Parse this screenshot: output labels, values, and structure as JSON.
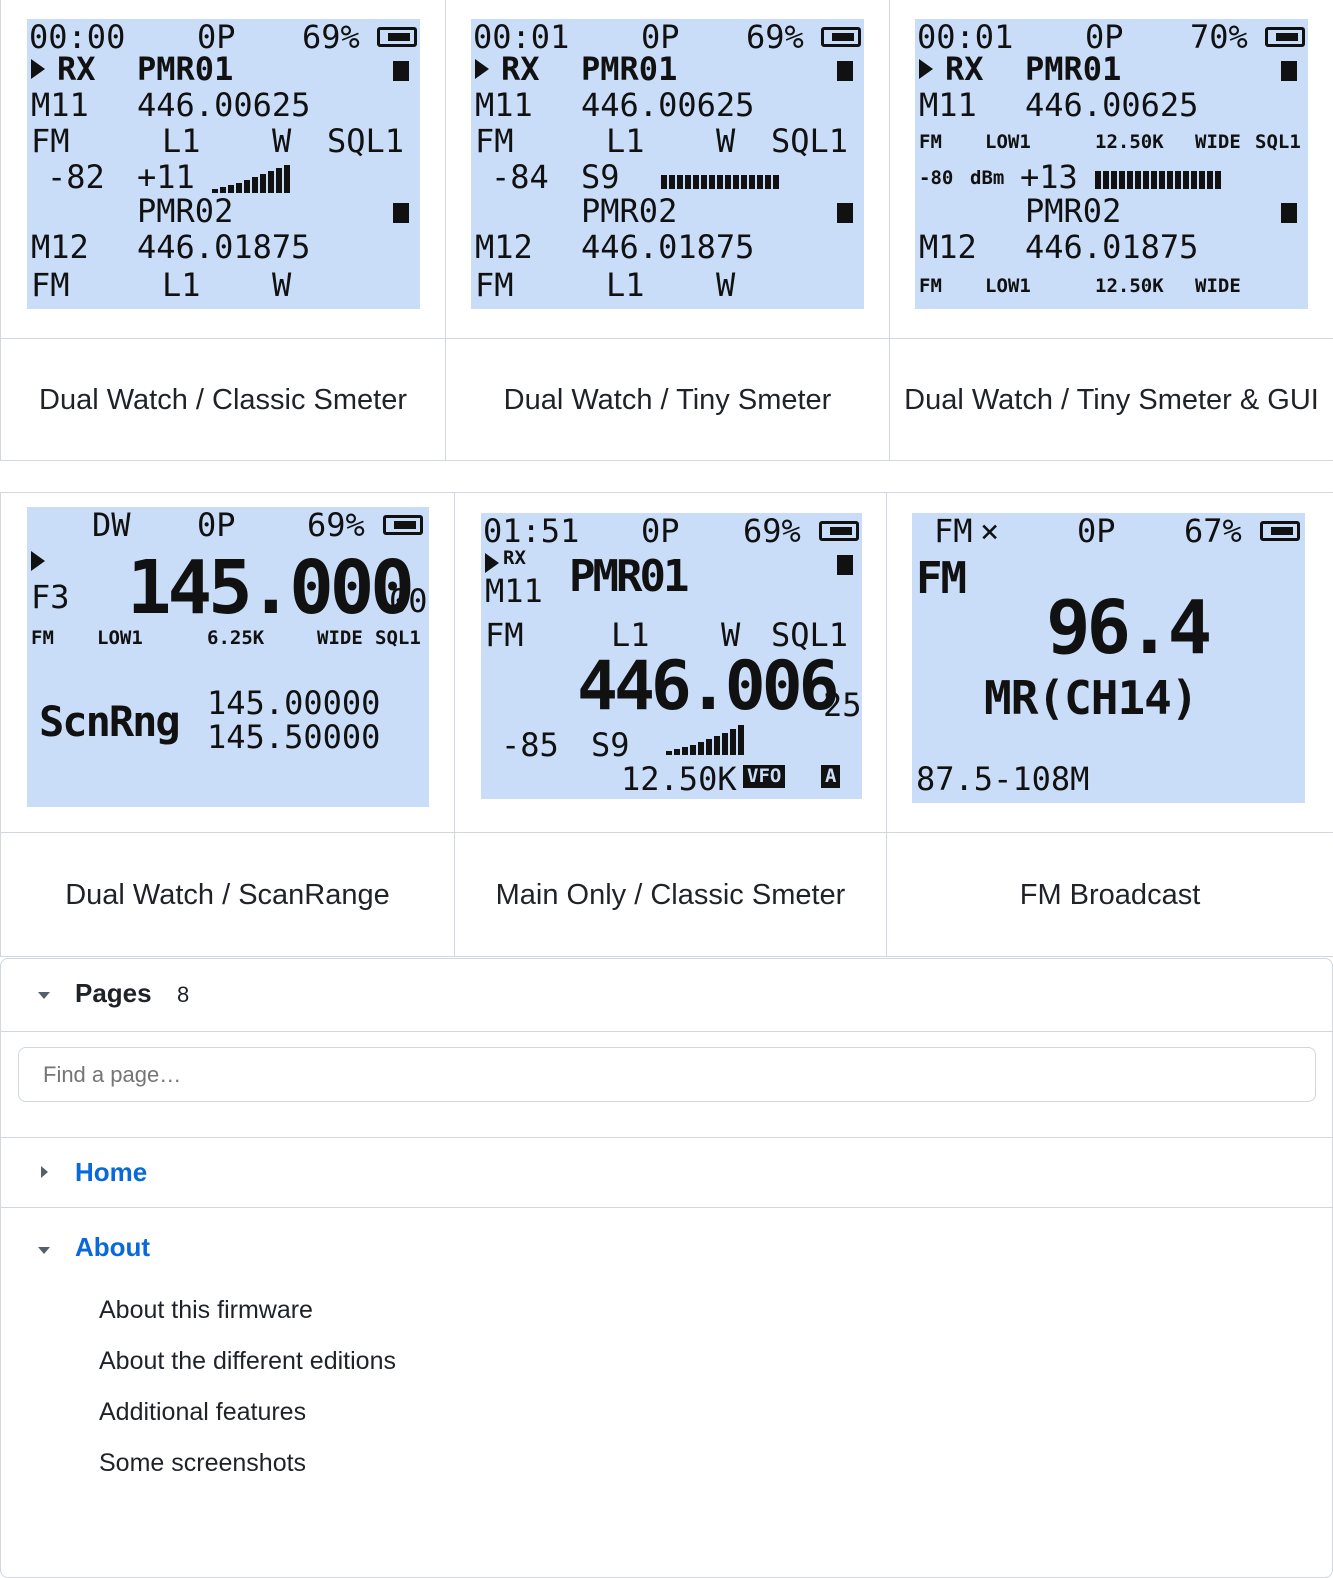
{
  "row1": [
    {
      "caption": "Dual Watch / Classic Smeter",
      "lines": [
        "00:00",
        "0P",
        "69%",
        "RX",
        "PMR01",
        "M11",
        "446.00625",
        "FM",
        "L1",
        "W",
        "SQL1",
        "-82",
        "+11",
        "PMR02",
        "M12",
        "446.01875",
        "FM",
        "L1",
        "W"
      ],
      "signal_level": 0.8
    },
    {
      "caption": "Dual Watch / Tiny Smeter",
      "lines": [
        "00:01",
        "0P",
        "69%",
        "RX",
        "PMR01",
        "M11",
        "446.00625",
        "FM",
        "L1",
        "W",
        "SQL1",
        "-84",
        "S9",
        "PMR02",
        "M12",
        "446.01875",
        "FM",
        "L1",
        "W"
      ],
      "signal_level": 1.0
    },
    {
      "caption": "Dual Watch / Tiny Smeter & GUI",
      "lines": [
        "00:01",
        "0P",
        "70%",
        "RX",
        "PMR01",
        "M11",
        "446.00625",
        "FM",
        "LOW1",
        "12.50K",
        "WIDE",
        "SQL1",
        "-80",
        "dBm",
        "+13",
        "PMR02",
        "M12",
        "446.01875",
        "FM",
        "LOW1",
        "12.50K",
        "WIDE"
      ],
      "signal_level": 0.9
    }
  ],
  "row2": [
    {
      "caption": "Dual Watch / ScanRange",
      "lines": [
        "DW",
        "0P",
        "69%",
        "F3",
        "145.000",
        "00",
        "FM",
        "LOW1",
        "6.25K",
        "WIDE",
        "SQL1",
        "ScnRng",
        "145.00000",
        "145.50000"
      ]
    },
    {
      "caption": "Main Only / Classic Smeter",
      "lines": [
        "01:51",
        "0P",
        "69%",
        "RX",
        "M11",
        "PMR01",
        "FM",
        "L1",
        "W",
        "SQL1",
        "446.006",
        "25",
        "-85",
        "S9",
        "12.50K",
        "VFO",
        "A"
      ],
      "signal_level": 0.75
    },
    {
      "caption": "FM Broadcast",
      "lines": [
        "FM",
        "0P",
        "67%",
        "FM",
        "96.4",
        "MR(CH14)",
        "87.5-108M"
      ]
    }
  ],
  "sidebar": {
    "title": "Pages",
    "count": "8",
    "search_placeholder": "Find a page…",
    "items": [
      {
        "label": "Home",
        "expanded": false
      },
      {
        "label": "About",
        "expanded": true,
        "children": [
          "About this firmware",
          "About the different editions",
          "Additional features",
          "Some screenshots"
        ]
      }
    ]
  }
}
